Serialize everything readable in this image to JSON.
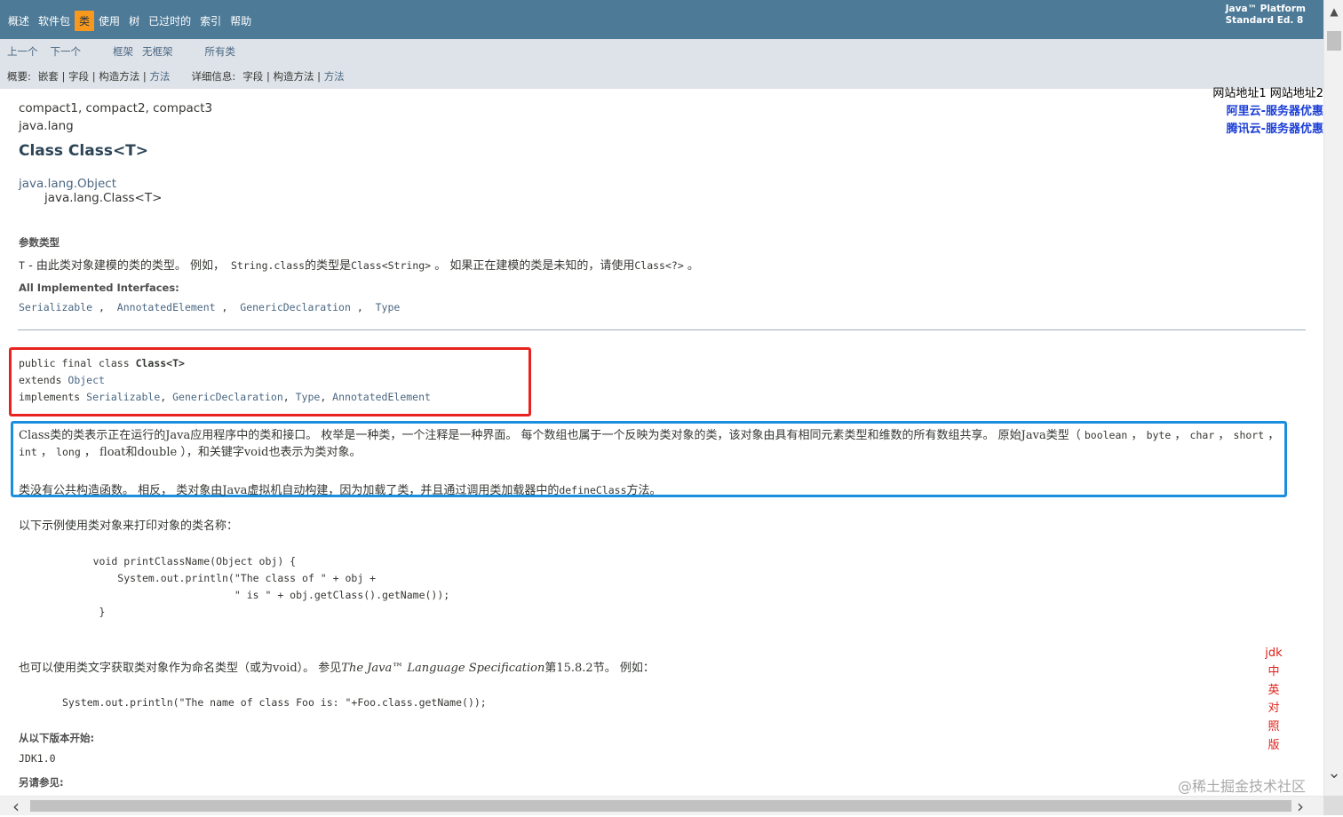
{
  "topnav": {
    "items": [
      "概述",
      "软件包",
      "类",
      "使用",
      "树",
      "已过时的",
      "索引",
      "帮助"
    ],
    "active_index": 2,
    "platform_line1": "Java™ Platform",
    "platform_line2": "Standard Ed. 8"
  },
  "subnav": {
    "prev": "上一个",
    "next": "下一个",
    "frames": "框架",
    "noframes": "无框架",
    "allclasses": "所有类",
    "summary_label": "概要:",
    "summary_items": "嵌套 | 字段 | 构造方法 | ",
    "summary_method": "方法",
    "detail_label": "详细信息:",
    "detail_items": "字段 | 构造方法 | ",
    "detail_method": "方法"
  },
  "side": {
    "links_plain": "网站地址1 网站地址2",
    "promo1": "阿里云-服务器优惠",
    "promo2": "腾讯云-服务器优惠",
    "jdk_vertical": "jdk中英对照版"
  },
  "content": {
    "profiles": "compact1, compact2, compact3",
    "package": "java.lang",
    "title": "Class Class<T>",
    "hierarchy_parent": "java.lang.Object",
    "hierarchy_child": "java.lang.Class<T>",
    "type_params_label": "参数类型",
    "type_param_line": {
      "t": "T",
      "dash": " - ",
      "desc1": "由此类对象建模的类的类型。 例如，",
      "code1": " String.class",
      "desc2": "的类型是",
      "code2": "Class<String>",
      "desc3": " 。 如果正在建模的类是未知的，请使用",
      "code3": "Class<?>",
      "desc4": " 。"
    },
    "interfaces_label": "All Implemented Interfaces:",
    "interfaces": [
      "Serializable",
      "AnnotatedElement",
      "GenericDeclaration",
      "Type"
    ],
    "decl": {
      "line1_kw": "public final class ",
      "line1_name": "Class<T>",
      "line2_kw": "extends ",
      "line2_link": "Object",
      "line3_kw": "implements ",
      "line3_links": [
        "Serializable",
        "GenericDeclaration",
        "Type",
        "AnnotatedElement"
      ]
    },
    "desc_para1_a": "Class类的类表示正在运行的Java应用程序中的类和接口。 枚举是一种类，一个注释是一种界面。 每个数组也属于一个反映为类对象的类，该对象由具有相同元素类型和维数的所有数组共享。 原始Java类型（ ",
    "desc_para1_codes_a": [
      "boolean",
      "byte",
      "char"
    ],
    "desc_para1_codes_b": [
      "short",
      "int",
      "long"
    ],
    "desc_para1_float": " float和double ",
    "desc_para1_tail": "），和关键字void也表示为类对象。",
    "desc_para2_a": "类没有公共构造函数。 相反， 类对象由Java虚拟机自动构建，因为加载了类，并且通过调用类加载器中的",
    "desc_para2_code": "defineClass",
    "desc_para2_b": "方法。",
    "example_intro": "以下示例使用类对象来打印对象的类名称：",
    "code_example": "     void printClassName(Object obj) {\n         System.out.println(\"The class of \" + obj +\n                            \" is \" + obj.getClass().getName());\n      }",
    "literal_intro_a": "也可以使用类文字获取类对象作为命名类型（或为void）。 参见",
    "literal_intro_spec": "The Java™ Language Specification",
    "literal_intro_b": "第15.8.2节。 例如：",
    "code_example2": "System.out.println(\"The name of class Foo is: \"+Foo.class.getName());",
    "since_label": "从以下版本开始:",
    "since_value": "JDK1.0",
    "see_also_label": "另请参见:"
  },
  "watermark": "@稀土掘金技术社区",
  "colors": {
    "topnav_bg": "#4d7a97",
    "active_tab": "#f8981d",
    "subnav_bg": "#dee3e9",
    "link": "#4a6782",
    "red_box": "#e8231f",
    "blue_box": "#1a8fe0"
  }
}
